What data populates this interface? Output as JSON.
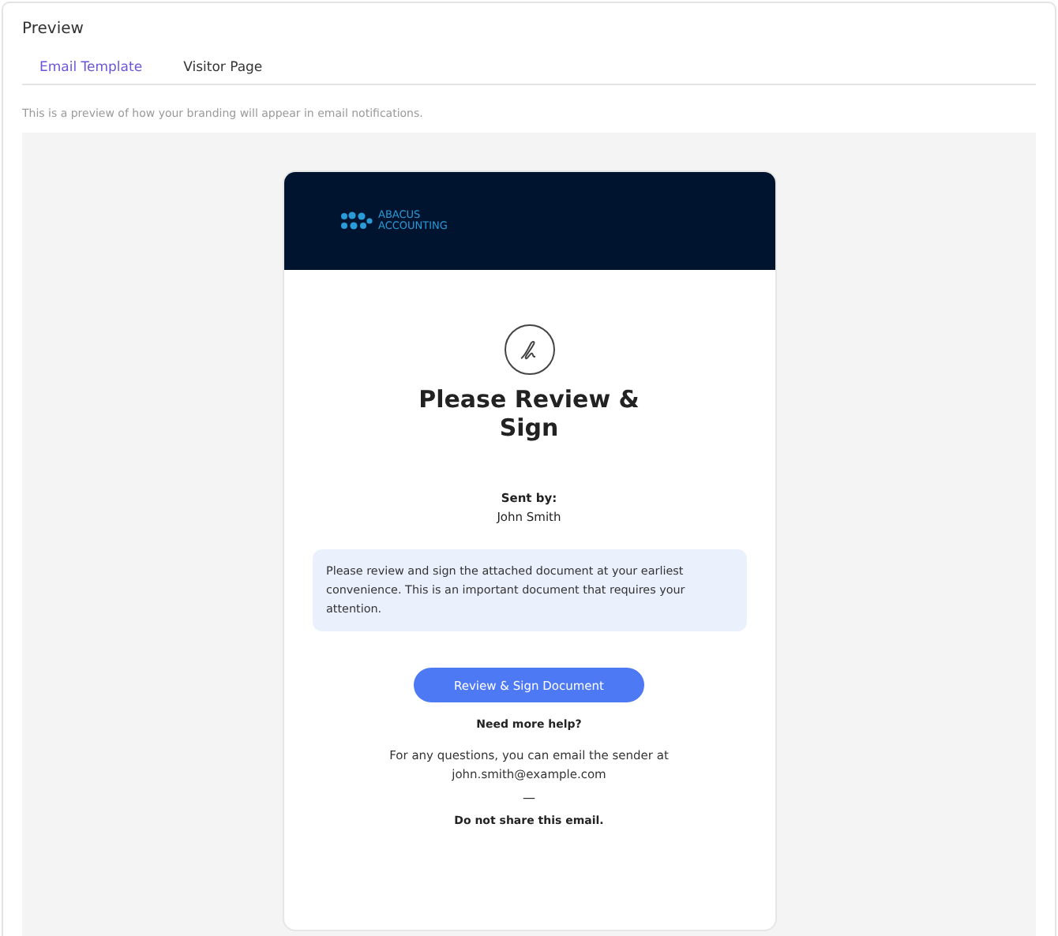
{
  "panel": {
    "title": "Preview"
  },
  "tabs": [
    {
      "label": "Email Template",
      "selected": true
    },
    {
      "label": "Visitor Page",
      "selected": false
    }
  ],
  "description": "This is a preview of how your branding will appear in email notifications.",
  "email": {
    "brand_lines": [
      "ABACUS",
      "ACCOUNTING"
    ],
    "heading": "Please Review & Sign",
    "sent_by_label": "Sent by:",
    "sender": "John Smith",
    "message": "Please review and sign the attached document at your earliest convenience. This is an important document that requires your attention.",
    "button": "Review & Sign Document",
    "help_title": "Need more help?",
    "help_text": "For any questions, you can email the sender at john.smith@example.com",
    "separator": "—",
    "footer": "Do not share this email."
  }
}
